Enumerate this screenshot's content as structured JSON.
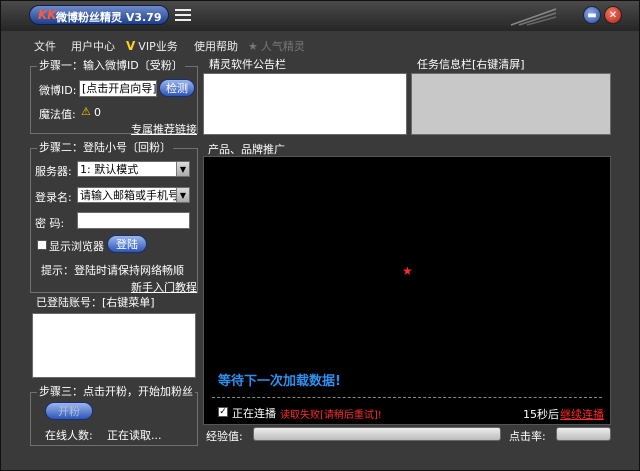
{
  "window": {
    "title": "微博粉丝精灵 V3.79",
    "logo_text": "KK"
  },
  "menu": {
    "file": "文件",
    "user_center": "用户中心",
    "vip_mark": "V",
    "vip": "VIP业务",
    "help": "使用帮助",
    "popular": "人气精灵"
  },
  "step1": {
    "title": "步骤一：输入微博ID〔受粉〕",
    "weibo_id_label": "微博ID:",
    "weibo_id_value": "[点击开启向导]",
    "detect_button": "检测",
    "magic_label": "魔法值:",
    "magic_value": "0",
    "recommend_link": "专属推荐链接"
  },
  "notice_panel": {
    "title": "精灵软件公告栏"
  },
  "task_panel": {
    "title": "任务信息栏[右键清屏]"
  },
  "step2": {
    "title": "步骤二：登陆小号〔回粉〕",
    "server_label": "服务器:",
    "server_value": "1: 默认模式",
    "login_label": "登录名:",
    "login_placeholder": "请输入邮箱或手机号",
    "password_label": "密  码:",
    "show_browser_label": "显示浏览器",
    "login_button": "登陆",
    "tip": "提示：登陆时请保持网络畅顺",
    "tutorial_link": "新手入门教程"
  },
  "logged_accounts": {
    "title": "已登陆账号：[右键菜单]"
  },
  "step3": {
    "title": "步骤三：点击开粉，开始加粉丝",
    "start_button": "开粉",
    "online_label": "在线人数:",
    "online_value": "正在读取..."
  },
  "promo": {
    "title": "产品、品牌推广",
    "waiting_text": "等待下一次加载数据!",
    "continuous_label": "正在连播",
    "fail_text": "读取失败[请稍后重试]!",
    "countdown": "15秒后",
    "continue_link": "继续连播"
  },
  "statusbar": {
    "exp_label": "经验值:",
    "click_rate_label": "点击率:"
  },
  "colors": {
    "accent_blue": "#2d56b8",
    "waiting_text": "#2e8ff0",
    "fail_text": "#ff2a2a",
    "vip_yellow": "#ffd21c"
  }
}
